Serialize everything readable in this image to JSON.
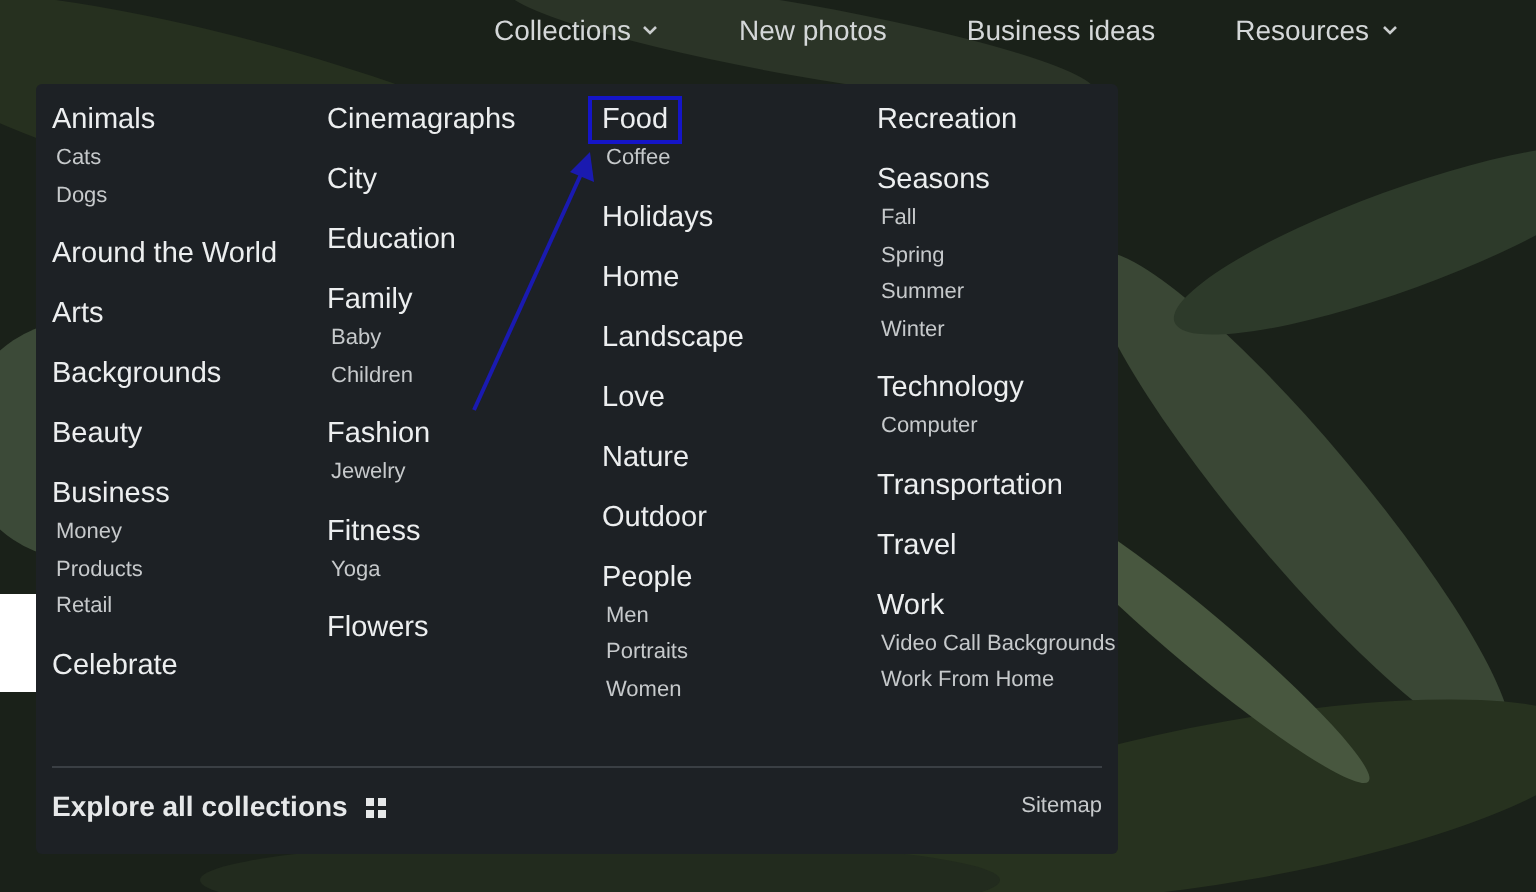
{
  "nav": [
    {
      "label": "Collections",
      "dropdown": true
    },
    {
      "label": "New photos",
      "dropdown": false
    },
    {
      "label": "Business ideas",
      "dropdown": false
    },
    {
      "label": "Resources",
      "dropdown": true
    }
  ],
  "menu": {
    "columns": [
      [
        {
          "label": "Animals",
          "highlighted": false,
          "children": [
            "Cats",
            "Dogs"
          ]
        },
        {
          "label": "Around the World",
          "highlighted": false
        },
        {
          "label": "Arts",
          "highlighted": false
        },
        {
          "label": "Backgrounds",
          "highlighted": false
        },
        {
          "label": "Beauty",
          "highlighted": false
        },
        {
          "label": "Business",
          "highlighted": false,
          "children": [
            "Money",
            "Products",
            "Retail"
          ]
        },
        {
          "label": "Celebrate",
          "highlighted": false
        }
      ],
      [
        {
          "label": "Cinemagraphs",
          "highlighted": false
        },
        {
          "label": "City",
          "highlighted": false
        },
        {
          "label": "Education",
          "highlighted": false
        },
        {
          "label": "Family",
          "highlighted": false,
          "children": [
            "Baby",
            "Children"
          ]
        },
        {
          "label": "Fashion",
          "highlighted": false,
          "children": [
            "Jewelry"
          ]
        },
        {
          "label": "Fitness",
          "highlighted": false,
          "children": [
            "Yoga"
          ]
        },
        {
          "label": "Flowers",
          "highlighted": false
        }
      ],
      [
        {
          "label": "Food",
          "highlighted": true,
          "children": [
            "Coffee"
          ]
        },
        {
          "label": "Holidays",
          "highlighted": false
        },
        {
          "label": "Home",
          "highlighted": false
        },
        {
          "label": "Landscape",
          "highlighted": false
        },
        {
          "label": "Love",
          "highlighted": false
        },
        {
          "label": "Nature",
          "highlighted": false
        },
        {
          "label": "Outdoor",
          "highlighted": false
        },
        {
          "label": "People",
          "highlighted": false,
          "children": [
            "Men",
            "Portraits",
            "Women"
          ]
        }
      ],
      [
        {
          "label": "Recreation",
          "highlighted": false
        },
        {
          "label": "Seasons",
          "highlighted": false,
          "children": [
            "Fall",
            "Spring",
            "Summer",
            "Winter"
          ]
        },
        {
          "label": "Technology",
          "highlighted": false,
          "children": [
            "Computer"
          ]
        },
        {
          "label": "Transportation",
          "highlighted": false
        },
        {
          "label": "Travel",
          "highlighted": false
        },
        {
          "label": "Work",
          "highlighted": false,
          "children": [
            "Video Call Backgrounds",
            "Work From Home"
          ]
        }
      ]
    ],
    "explore": "Explore all collections",
    "sitemap": "Sitemap"
  }
}
